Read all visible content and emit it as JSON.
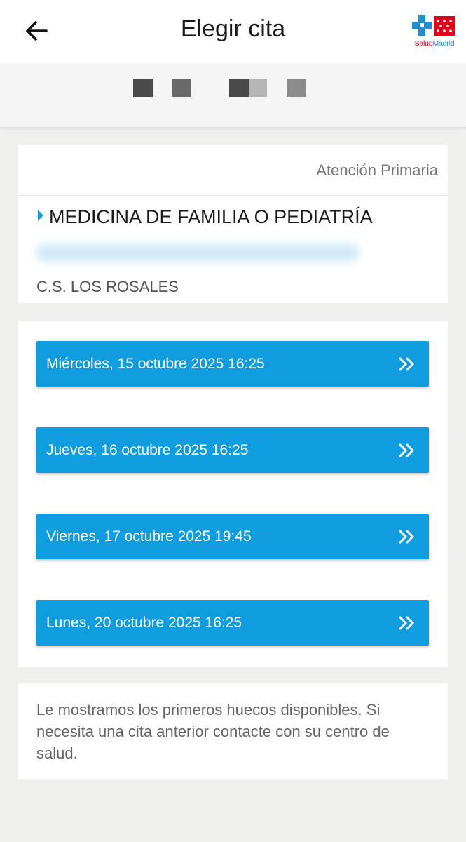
{
  "header": {
    "title": "Elegir cita",
    "back_icon": "arrow-left-icon",
    "brand": {
      "salud": "Salud",
      "madrid": "Madrid",
      "colors": {
        "red": "#e2001a",
        "blue": "#1f8fd1"
      }
    }
  },
  "info": {
    "care_level": "Atención Primaria",
    "specialty": "MEDICINA DE FAMILIA O PEDIATRÍA",
    "center": "C.S. LOS ROSALES"
  },
  "slots": [
    {
      "label": "Miércoles, 15 octubre 2025 16:25",
      "icon": "double-chevron-right-icon"
    },
    {
      "label": "Jueves, 16 octubre 2025 16:25",
      "icon": "double-chevron-right-icon"
    },
    {
      "label": "Viernes, 17 octubre 2025 19:45",
      "icon": "double-chevron-right-icon"
    },
    {
      "label": "Lunes, 20 octubre 2025 16:25",
      "icon": "double-chevron-right-icon"
    }
  ],
  "note": "Le mostramos los primeros huecos disponibles. Si necesita una cita anterior contacte con su centro de salud.",
  "colors": {
    "accent": "#0f9de0",
    "background": "#f0f0ef",
    "card": "#ffffff"
  }
}
